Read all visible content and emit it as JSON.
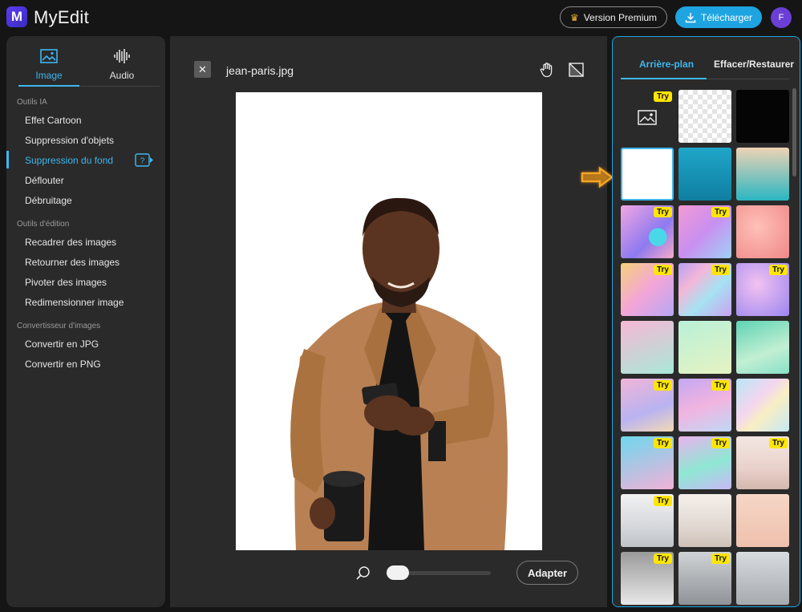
{
  "app": {
    "logo_letter": "M",
    "name": "MyEdit"
  },
  "header": {
    "premium_label": "Version Premium",
    "download_label": "Télécharger",
    "avatar_letter": "F",
    "accent_color": "#1ea4e0"
  },
  "media_tabs": [
    {
      "label": "Image",
      "icon": "image-icon",
      "active": true
    },
    {
      "label": "Audio",
      "icon": "audio-waveform-icon",
      "active": false
    }
  ],
  "sidebar": {
    "sections": [
      {
        "title": "Outils IA",
        "items": [
          "Effet Cartoon",
          "Suppression d'objets",
          "Suppression du fond",
          "Déflouter",
          "Débruitage"
        ]
      },
      {
        "title": "Outils d'édition",
        "items": [
          "Recadrer des images",
          "Retourner des images",
          "Pivoter des images",
          "Redimensionner image"
        ]
      },
      {
        "title": "Convertisseur d'images",
        "items": [
          "Convertir en JPG",
          "Convertir en PNG"
        ]
      }
    ],
    "active_item": "Suppression du fond"
  },
  "editor": {
    "file_name": "jean-paris.jpg",
    "fit_label": "Adapter",
    "zoom_level": 0.1
  },
  "background_panel": {
    "tabs": [
      "Arrière-plan",
      "Effacer/Restaurer"
    ],
    "active_tab": "Arrière-plan",
    "try_badge": "Try",
    "selected": "white",
    "tiles": [
      {
        "name": "upload-image",
        "try": true
      },
      {
        "name": "transparent",
        "try": false
      },
      {
        "name": "black",
        "try": false
      },
      {
        "name": "white",
        "try": false
      },
      {
        "name": "teal-gradient",
        "try": false
      },
      {
        "name": "beige-teal-gradient",
        "try": false
      },
      {
        "name": "pink-bubbles",
        "try": true
      },
      {
        "name": "pink-sparkle",
        "try": true
      },
      {
        "name": "salmon-bokeh",
        "try": false
      },
      {
        "name": "pastel-bokeh",
        "try": true
      },
      {
        "name": "holographic-swirl",
        "try": true
      },
      {
        "name": "purple-glitter",
        "try": true
      },
      {
        "name": "pink-mint-gradient",
        "try": false
      },
      {
        "name": "mint-gradient",
        "try": false
      },
      {
        "name": "green-light-rays",
        "try": false
      },
      {
        "name": "lavender-gradient",
        "try": true
      },
      {
        "name": "lilac-gradient",
        "try": true
      },
      {
        "name": "rainbow-stripes",
        "try": false
      },
      {
        "name": "aqua-pink-gradient",
        "try": true
      },
      {
        "name": "holo-mint",
        "try": true
      },
      {
        "name": "pink-beach",
        "try": true
      },
      {
        "name": "grey-sea",
        "try": true
      },
      {
        "name": "pale-sea",
        "try": false
      },
      {
        "name": "peach-tree",
        "try": false
      },
      {
        "name": "grey-fog",
        "try": true
      },
      {
        "name": "misty-forest",
        "try": true
      },
      {
        "name": "silver-gradient",
        "try": false
      }
    ]
  }
}
